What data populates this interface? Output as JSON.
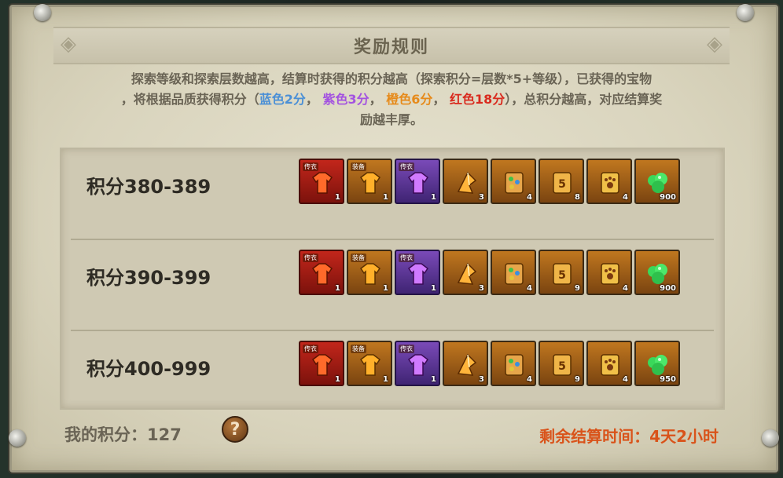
{
  "panel": {
    "title": "奖励规则"
  },
  "description": {
    "line1": "探索等级和探索层数越高，结算时获得的积分越高（探索积分=层数*5+等级），已获得的宝物",
    "line2_prefix": "，将根据品质获得积分（",
    "blue": "蓝色2分",
    "purple": "紫色3分",
    "orange": "橙色6分",
    "red": "红色18分",
    "line2_suffix": "），总积分越高，对应结算奖",
    "line3": "励越丰厚。"
  },
  "colors": {
    "blue": "#4a8fd6",
    "purple": "#a352e0",
    "orange": "#e68a1a",
    "red": "#d92a1e",
    "countdown": "#d9531a"
  },
  "rows": [
    {
      "label": "积分380-389",
      "items": [
        {
          "icon": "red-robe-icon",
          "tier": "red",
          "tag": "传衣",
          "count": "1"
        },
        {
          "icon": "orange-robe-icon",
          "tier": "gold",
          "tag": "装备",
          "count": "1"
        },
        {
          "icon": "purple-robe-icon",
          "tier": "purple",
          "tag": "传衣",
          "count": "1"
        },
        {
          "icon": "orange-shard-icon",
          "tier": "gold",
          "tag": "",
          "count": "3"
        },
        {
          "icon": "scroll-gems-icon",
          "tier": "gold",
          "tag": "",
          "count": "4"
        },
        {
          "icon": "scroll-5-icon",
          "tier": "gold",
          "tag": "",
          "count": "8"
        },
        {
          "icon": "scroll-paw-icon",
          "tier": "gold",
          "tag": "",
          "count": "4"
        },
        {
          "icon": "green-jade-icon",
          "tier": "gold",
          "tag": "",
          "count": "900"
        }
      ]
    },
    {
      "label": "积分390-399",
      "items": [
        {
          "icon": "red-robe-icon",
          "tier": "red",
          "tag": "传衣",
          "count": "1"
        },
        {
          "icon": "orange-robe-icon",
          "tier": "gold",
          "tag": "装备",
          "count": "1"
        },
        {
          "icon": "purple-robe-icon",
          "tier": "purple",
          "tag": "传衣",
          "count": "1"
        },
        {
          "icon": "orange-shard-icon",
          "tier": "gold",
          "tag": "",
          "count": "3"
        },
        {
          "icon": "scroll-gems-icon",
          "tier": "gold",
          "tag": "",
          "count": "4"
        },
        {
          "icon": "scroll-5-icon",
          "tier": "gold",
          "tag": "",
          "count": "9"
        },
        {
          "icon": "scroll-paw-icon",
          "tier": "gold",
          "tag": "",
          "count": "4"
        },
        {
          "icon": "green-jade-icon",
          "tier": "gold",
          "tag": "",
          "count": "900"
        }
      ]
    },
    {
      "label": "积分400-999",
      "items": [
        {
          "icon": "red-robe-icon",
          "tier": "red",
          "tag": "传衣",
          "count": "1"
        },
        {
          "icon": "orange-robe-icon",
          "tier": "gold",
          "tag": "装备",
          "count": "1"
        },
        {
          "icon": "purple-robe-icon",
          "tier": "purple",
          "tag": "传衣",
          "count": "1"
        },
        {
          "icon": "orange-shard-icon",
          "tier": "gold",
          "tag": "",
          "count": "3"
        },
        {
          "icon": "scroll-gems-icon",
          "tier": "gold",
          "tag": "",
          "count": "4"
        },
        {
          "icon": "scroll-5-icon",
          "tier": "gold",
          "tag": "",
          "count": "9"
        },
        {
          "icon": "scroll-paw-icon",
          "tier": "gold",
          "tag": "",
          "count": "4"
        },
        {
          "icon": "green-jade-icon",
          "tier": "gold",
          "tag": "",
          "count": "950"
        }
      ]
    }
  ],
  "footer": {
    "my_score_label": "我的积分：",
    "my_score_value": "127",
    "help_symbol": "?",
    "countdown_label": "剩余结算时间：",
    "countdown_value": "4天2小时"
  }
}
